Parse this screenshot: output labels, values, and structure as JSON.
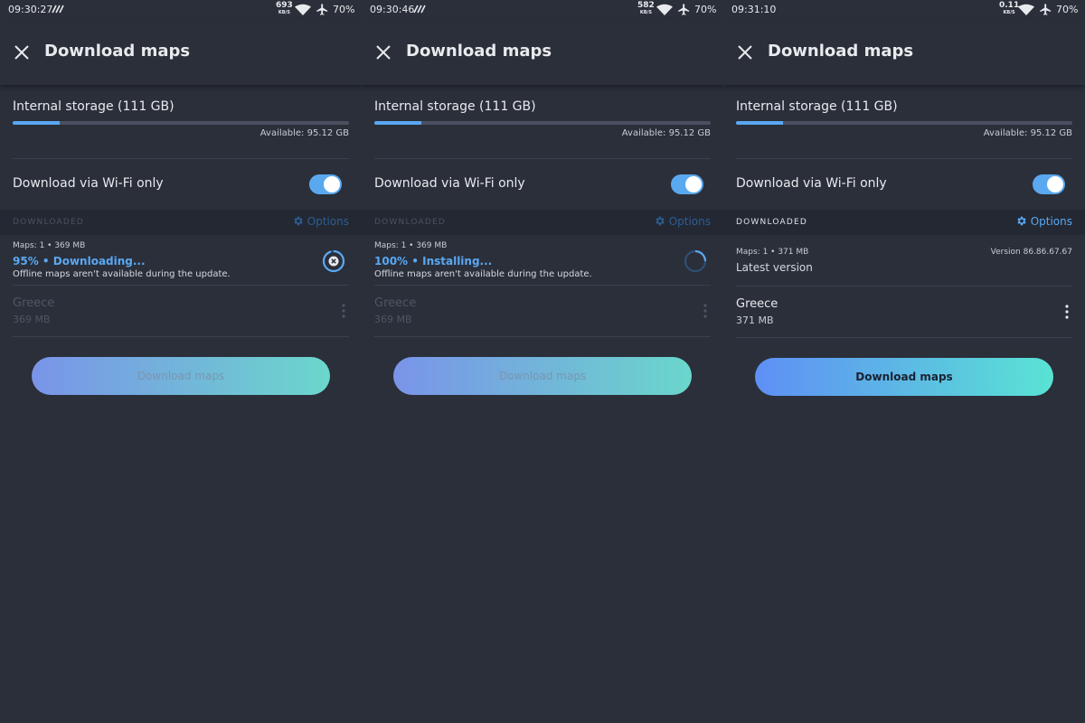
{
  "screens": [
    {
      "status": {
        "time": "09:30:27",
        "netspeed": "693",
        "netspeed_unit": "KB/S",
        "battery": "70%"
      },
      "title": "Download maps",
      "storage": {
        "label": "Internal storage (111 GB)",
        "available": "Available: 95.12 GB",
        "used_fraction": 0.14
      },
      "wifi_label": "Download via Wi-Fi only",
      "wifi_enabled": true,
      "section": {
        "title": "DOWNLOADED",
        "options": "Options"
      },
      "maps_count": "Maps: 1 • 369 MB",
      "status_text": "95% • Downloading...",
      "note": "Offline maps aren't available during the update.",
      "region": {
        "name": "Greece",
        "size": "369 MB"
      },
      "button": "Download maps"
    },
    {
      "status": {
        "time": "09:30:46",
        "netspeed": "582",
        "netspeed_unit": "KB/S",
        "battery": "70%"
      },
      "title": "Download maps",
      "storage": {
        "label": "Internal storage (111 GB)",
        "available": "Available: 95.12 GB",
        "used_fraction": 0.14
      },
      "wifi_label": "Download via Wi-Fi only",
      "wifi_enabled": true,
      "section": {
        "title": "DOWNLOADED",
        "options": "Options"
      },
      "maps_count": "Maps: 1 • 369 MB",
      "status_text": "100% • Installing...",
      "note": "Offline maps aren't available during the update.",
      "region": {
        "name": "Greece",
        "size": "369 MB"
      },
      "button": "Download maps"
    },
    {
      "status": {
        "time": "09:31:10",
        "netspeed": "0.11",
        "netspeed_unit": "KB/S",
        "battery": "70%"
      },
      "title": "Download maps",
      "storage": {
        "label": "Internal storage (111 GB)",
        "available": "Available: 95.12 GB",
        "used_fraction": 0.14
      },
      "wifi_label": "Download via Wi-Fi only",
      "wifi_enabled": true,
      "section": {
        "title": "DOWNLOADED",
        "options": "Options"
      },
      "maps_count": "Maps: 1 • 371 MB",
      "version": "Version 86.86.67.67",
      "latest": "Latest version",
      "region": {
        "name": "Greece",
        "size": "371 MB"
      },
      "button": "Download maps"
    }
  ],
  "download_progress": 0.95,
  "colors": {
    "accent": "#5aa8f2",
    "background": "#2a2f3a",
    "section_bg": "#232833"
  },
  "icons": [
    "close-icon",
    "gear-icon",
    "cancel-download-icon",
    "loading-spinner-icon",
    "more-vert-icon",
    "wifi-icon",
    "airplane-icon"
  ]
}
